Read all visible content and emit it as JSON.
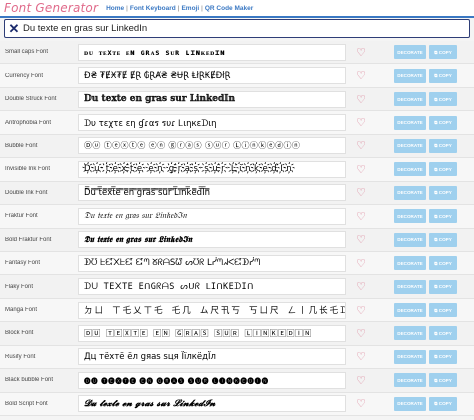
{
  "header": {
    "logo": "Font Generator",
    "nav": [
      "Home",
      "Font Keyboard",
      "Emoji",
      "QR Code Maker"
    ],
    "separator": "|"
  },
  "search": {
    "value": "Du texte en gras sur LinkedIn",
    "clear_icon": "close-icon"
  },
  "buttons": {
    "decorate": "DECORATE",
    "copy": "COPY",
    "copy_icon": "copy-icon",
    "favorite_icon": "heart-icon"
  },
  "colors": {
    "accent_blue": "#3a78c3",
    "logo_pink": "#e06a8a",
    "button_blue": "#9fd0ee",
    "heart_pink": "#d8748c",
    "search_border": "#2e3d77"
  },
  "rows": [
    {
      "name": "Small caps Font",
      "output": "ᴅᴜ ᴛᴇxᴛᴇ ᴇɴ ɢʀᴀs sᴜʀ ʟɪɴᴋᴇᴅɪɴ"
    },
    {
      "name": "Currency Font",
      "output": "Đ₴ ₮ɆӾ₮Ɇ ɆⱤ ₲ⱤȺ₴ ₴ɄⱤ ⱠłⱤ₭ɆĐłⱤ"
    },
    {
      "name": "Double Struck Font",
      "output": "𝔻𝕦 𝕥𝕖𝕩𝕥𝕖 𝕖𝕟 𝕘𝕣𝕒𝕤 𝕤𝕦𝕣 𝕃𝕚𝕟𝕜𝕖𝕕𝕀𝕟"
    },
    {
      "name": "Antrophobia Font",
      "output": "ᗪυ τεχτε εη ɠɾαร รυɾ Ꮮιηкεᗪιη"
    },
    {
      "name": "Bubble Font",
      "output": "Ⓓⓤ ⓣⓔⓧⓣⓔ ⓔⓝ ⓖⓡⓐⓢ ⓢⓤⓡ Ⓛⓘⓝⓚⓔⓓⓘⓝ"
    },
    {
      "name": "Invisible Ink Font",
      "output": "D҉u҉ t҉e҉x҉t҉e҉ e҉n҉ g҉r҉a҉s҉ s҉u҉r҉ L҉i҉n҉k҉e҉d҉I҉n҉"
    },
    {
      "name": "Double Ink Font",
      "output": "D̿u̿ ̿t̿e̿x̿t̿e̿ ̿e̿n̿ ̿g̿r̿a̿s̿ ̿s̿u̿r̿ ̿L̿i̿n̿k̿e̿d̿I̿n̿"
    },
    {
      "name": "Fraktur Font",
      "output": "𝔇𝔲 𝔱𝔢𝔵𝔱𝔢 𝔢𝔫 𝔤𝔯𝔞𝔰 𝔰𝔲𝔯 𝔏𝔦𝔫𝔨𝔢𝔡ℑ𝔫"
    },
    {
      "name": "Bold Fraktur Font",
      "output": "𝕯𝖚 𝖙𝖊𝖝𝖙𝖊 𝖊𝖓 𝖌𝖗𝖆𝖘 𝖘𝖚𝖗 𝕷𝖎𝖓𝖐𝖊𝖉𝕴𝖓"
    },
    {
      "name": "Fantasy Font",
      "output": "ᗫᘮ ᖶᘿ᙭ᖶᘿ ᘿᘉ ᘜᖇᗩSᘺ ᔕᘮᖇ ᒪᓰᘉᖽᐸᘿᗫᓰᘉ"
    },
    {
      "name": "Flaky Font",
      "output": "ᗪᑌ TE᙭TE EᑎGᖇᗩS ᔕᑌᖇ ᒪIᑎKEᗪIᑎ"
    },
    {
      "name": "Manga Font",
      "output": "ㄉㄩ ㄒ乇乂ㄒ乇 乇几 ム尺卂丂 丂ㄩ尺 ㄥ丨几长乇ᗪ丨几"
    },
    {
      "name": "Block Font",
      "output": "🄳🅄 🅃🄴🅇🅃🄴 🄴🄽 🄶🅁🄰🅂 🅂🅄🅁 🄻🄸🄽🄺🄴🄳🄸🄽"
    },
    {
      "name": "Rusify Font",
      "output": "Дц тёхтё ёл gяаѕ ѕця ЇїлкёдЇл"
    },
    {
      "name": "Black bubble Font",
      "output": "🅓🅤 🅣🅔🅧🅣🅔 🅔🅝 🅖🅡🅐🅢 🅢🅤🅡 🅛🅘🅝🅚🅔🅓🅘🅝"
    },
    {
      "name": "Bold Script Font",
      "output": "𝓓𝓾 𝓽𝓮𝔁𝓽𝓮 𝓮𝓷 𝓰𝓻𝓪𝓼 𝓼𝓾𝓻 𝓛𝓲𝓷𝓴𝓮𝓭𝓘𝓷"
    }
  ]
}
